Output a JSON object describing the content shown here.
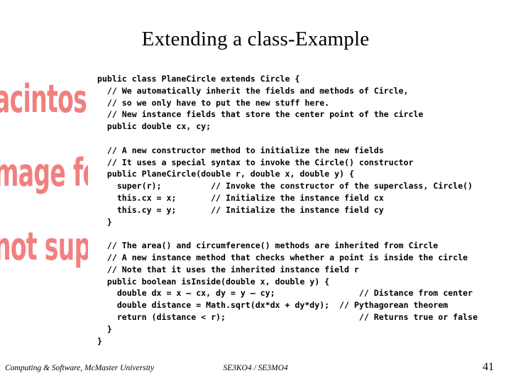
{
  "slide": {
    "title": "Extending a class-Example",
    "page_number": "41",
    "background_color": "#ffffff",
    "text_color": "#000000"
  },
  "broken_image_placeholder": {
    "description": "clipped QuickTime / Macintosh PICT decompressor missing-image notice",
    "color": "#f08080",
    "lines": [
      "acintosh P",
      "mage form",
      "not suppo"
    ]
  },
  "code": {
    "language": "java",
    "lines": [
      "public class PlaneCircle extends Circle {",
      "  // We automatically inherit the fields and methods of Circle,",
      "  // so we only have to put the new stuff here.",
      "  // New instance fields that store the center point of the circle",
      "  public double cx, cy;",
      "",
      "  // A new constructor method to initialize the new fields",
      "  // It uses a special syntax to invoke the Circle() constructor",
      "  public PlaneCircle(double r, double x, double y) {",
      "    super(r);          // Invoke the constructor of the superclass, Circle()",
      "    this.cx = x;       // Initialize the instance field cx",
      "    this.cy = y;       // Initialize the instance field cy",
      "  }",
      "",
      "  // The area() and circumference() methods are inherited from Circle",
      "  // A new instance method that checks whether a point is inside the circle",
      "  // Note that it uses the inherited instance field r",
      "  public boolean isInside(double x, double y) {",
      "    double dx = x – cx, dy = y – cy;                 // Distance from center",
      "    double distance = Math.sqrt(dx*dx + dy*dy);  // Pythagorean theorem",
      "    return (distance < r);                           // Returns true or false",
      "  }",
      "}"
    ]
  },
  "footer": {
    "left": "Computing & Software, McMaster University",
    "center": "SE3KO4 / SE3MO4"
  }
}
